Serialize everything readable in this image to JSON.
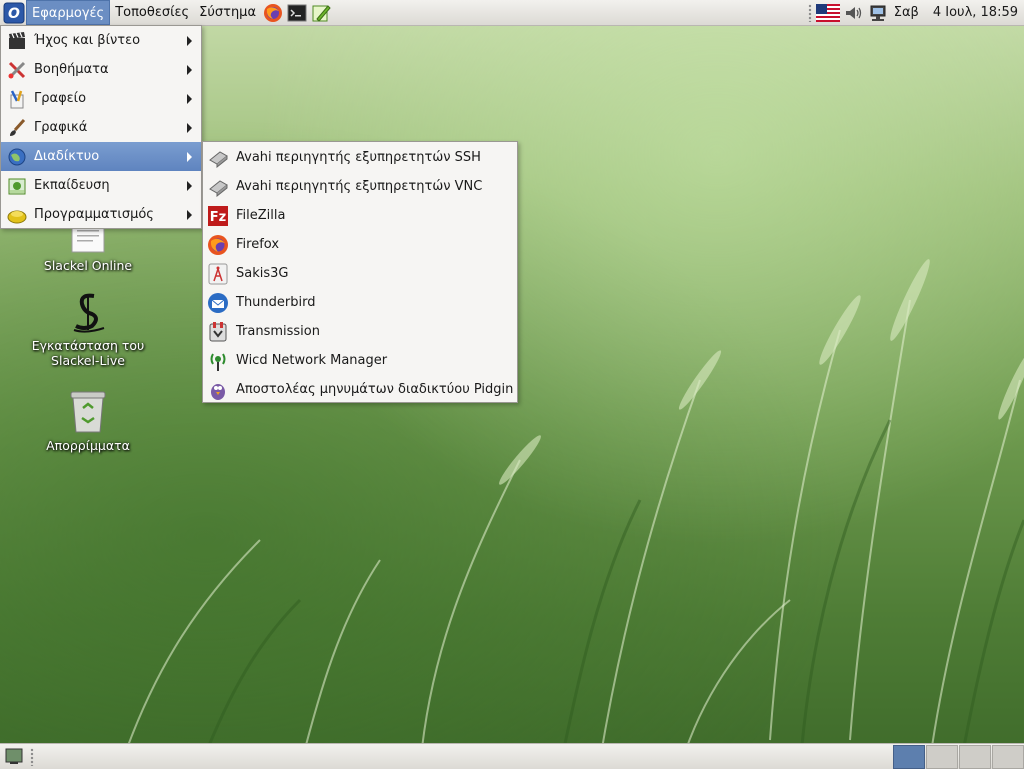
{
  "top_panel": {
    "menus": [
      "Εφαρμογές",
      "Τοποθεσίες",
      "Σύστημα"
    ],
    "launchers": [
      "firefox-icon",
      "terminal-icon",
      "text-editor-icon"
    ],
    "tray": {
      "icons": [
        "us-flag-icon",
        "volume-icon",
        "network-icon"
      ],
      "day": "Σαβ",
      "datetime": "4 Ιουλ, 18:59"
    }
  },
  "app_menu": {
    "items": [
      {
        "label": "Ήχος και βίντεο",
        "icon": "clapperboard-icon"
      },
      {
        "label": "Βοηθήματα",
        "icon": "accessories-icon"
      },
      {
        "label": "Γραφείο",
        "icon": "office-icon"
      },
      {
        "label": "Γραφικά",
        "icon": "paintbrush-icon"
      },
      {
        "label": "Διαδίκτυο",
        "icon": "globe-icon",
        "highlighted": true
      },
      {
        "label": "Εκπαίδευση",
        "icon": "education-icon"
      },
      {
        "label": "Προγραμματισμός",
        "icon": "programming-icon"
      }
    ]
  },
  "internet_submenu": {
    "items": [
      {
        "label": "Avahi περιηγητής εξυπηρετητών SSH",
        "icon": "avahi-ssh-icon"
      },
      {
        "label": "Avahi περιηγητής εξυπηρετητών VNC",
        "icon": "avahi-vnc-icon"
      },
      {
        "label": "FileZilla",
        "icon": "filezilla-icon"
      },
      {
        "label": "Firefox",
        "icon": "firefox-icon"
      },
      {
        "label": "Sakis3G",
        "icon": "sakis3g-icon"
      },
      {
        "label": "Thunderbird",
        "icon": "thunderbird-icon"
      },
      {
        "label": "Transmission",
        "icon": "transmission-icon"
      },
      {
        "label": "Wicd Network Manager",
        "icon": "wicd-icon"
      },
      {
        "label": "Αποστολέας μηνυμάτων διαδικτύου Pidgin",
        "icon": "pidgin-icon"
      }
    ]
  },
  "desktop": {
    "icons": [
      {
        "label": "Slackel Online",
        "icon": "document-icon"
      },
      {
        "label": "Εγκατάσταση του Slackel-Live",
        "icon": "slackel-logo-icon"
      },
      {
        "label": "Απορρίμματα",
        "icon": "trash-icon"
      }
    ]
  },
  "bottom_panel": {
    "workspaces": 4,
    "active_workspace": 1,
    "show_desktop_icon": "show-desktop-icon"
  },
  "colors": {
    "highlight": "#6b8ec3",
    "panel": "#e6e5e1",
    "menu_bg": "#f6f5f3"
  }
}
